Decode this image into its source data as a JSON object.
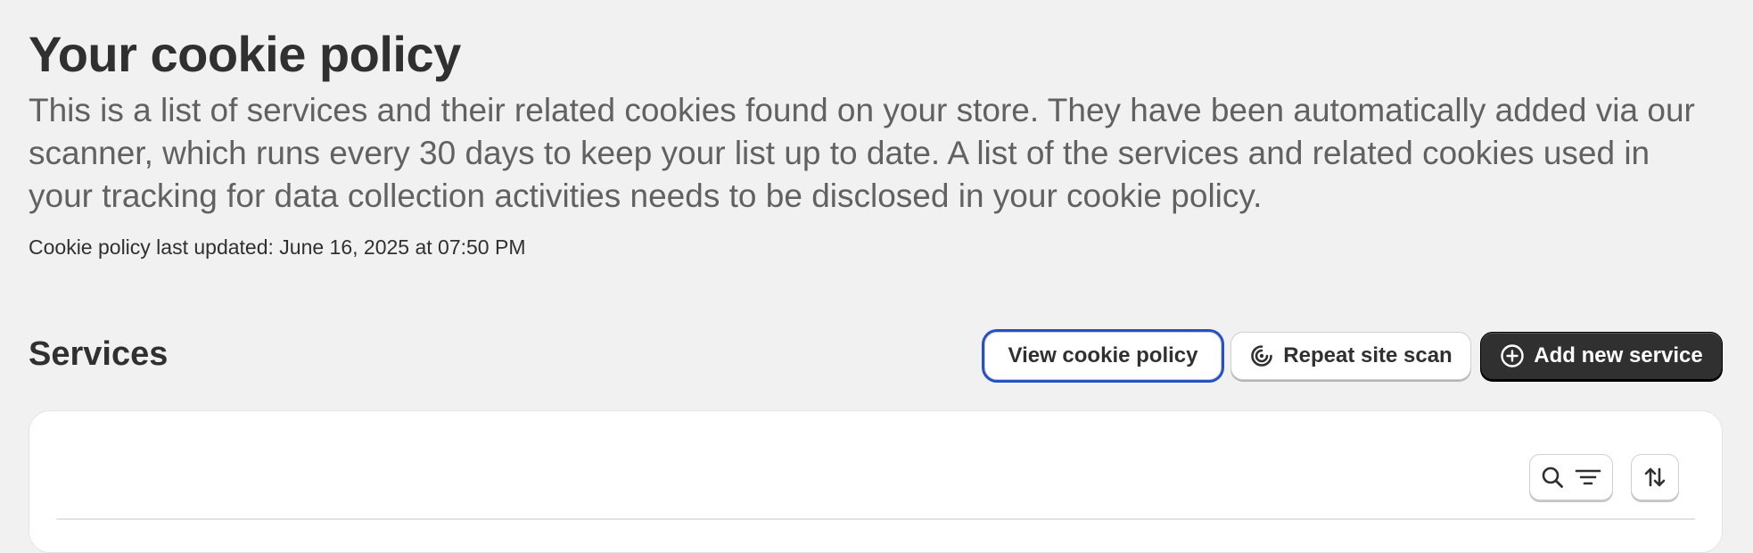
{
  "page": {
    "title": "Your cookie policy",
    "description": "This is a list of services and their related cookies found on your store. They have been automatically added via our scanner, which runs every 30 days to keep your list up to date. A list of the services and related cookies used in your tracking for data collection activities needs to be disclosed in your cookie policy.",
    "last_updated": "Cookie policy last updated: June 16, 2025 at 07:50 PM"
  },
  "services": {
    "heading": "Services",
    "actions": {
      "view_cookie_policy": "View cookie policy",
      "repeat_site_scan": "Repeat site scan",
      "add_new_service": "Add new service"
    },
    "table_toolbar": {
      "icons": [
        "search-icon",
        "filter-icon",
        "sort-icon"
      ]
    }
  },
  "colors": {
    "background": "#f1f1f1",
    "text_primary": "#303030",
    "text_secondary": "#616161",
    "focus_ring": "#2452c6",
    "primary_button": "#303030",
    "card_background": "#ffffff"
  }
}
